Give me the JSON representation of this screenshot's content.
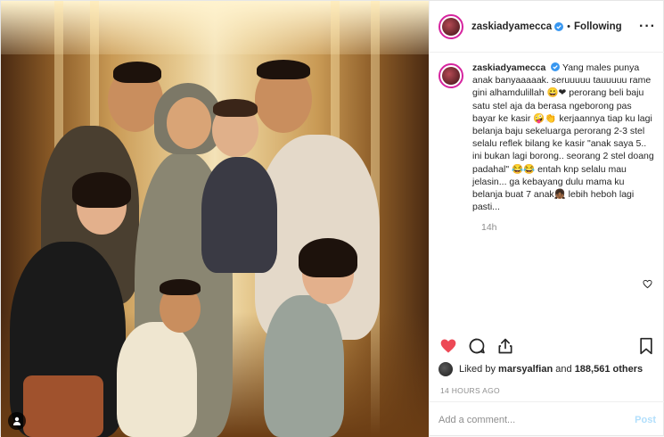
{
  "post": {
    "username": "zaskiadyamecca",
    "verified": true,
    "follow_status": "Following",
    "more_icon": "more-horizontal-icon"
  },
  "caption": {
    "username": "zaskiadyamecca",
    "text": "Yang males punya anak banyaaaaak. seruuuuu tauuuuu rame gini alhamdulillah 😀❤ perorang beli baju satu stel aja da berasa ngeborong pas bayar ke kasir 🤪👏 kerjaannya tiap ku lagi belanja baju sekeluarga perorang 2-3 stel selalu reflek bilang ke kasir \"anak saya 5.. ini bukan lagi borong.. seorang 2 stel doang padahal\" 😂😂 entah knp selalu mau jelasin... ga kebayang dulu mama ku belanja buat 7 anak👧🏾 lebih heboh lagi pasti...",
    "time": "14h"
  },
  "actions": {
    "like_icon": "heart-filled-icon",
    "comment_icon": "comment-icon",
    "share_icon": "share-icon",
    "save_icon": "bookmark-icon",
    "like_color": "#ed4956"
  },
  "likes": {
    "prefix": "Liked by ",
    "first_user": "marsyalfian",
    "connector": " and ",
    "count": "188,561 others"
  },
  "posted_ago": "14 HOURS AGO",
  "comment": {
    "placeholder": "Add a comment...",
    "post_label": "Post"
  },
  "colors": {
    "verified": "#3897f0",
    "post_disabled": "#b2dffc",
    "story_ring": "#d6249f"
  }
}
